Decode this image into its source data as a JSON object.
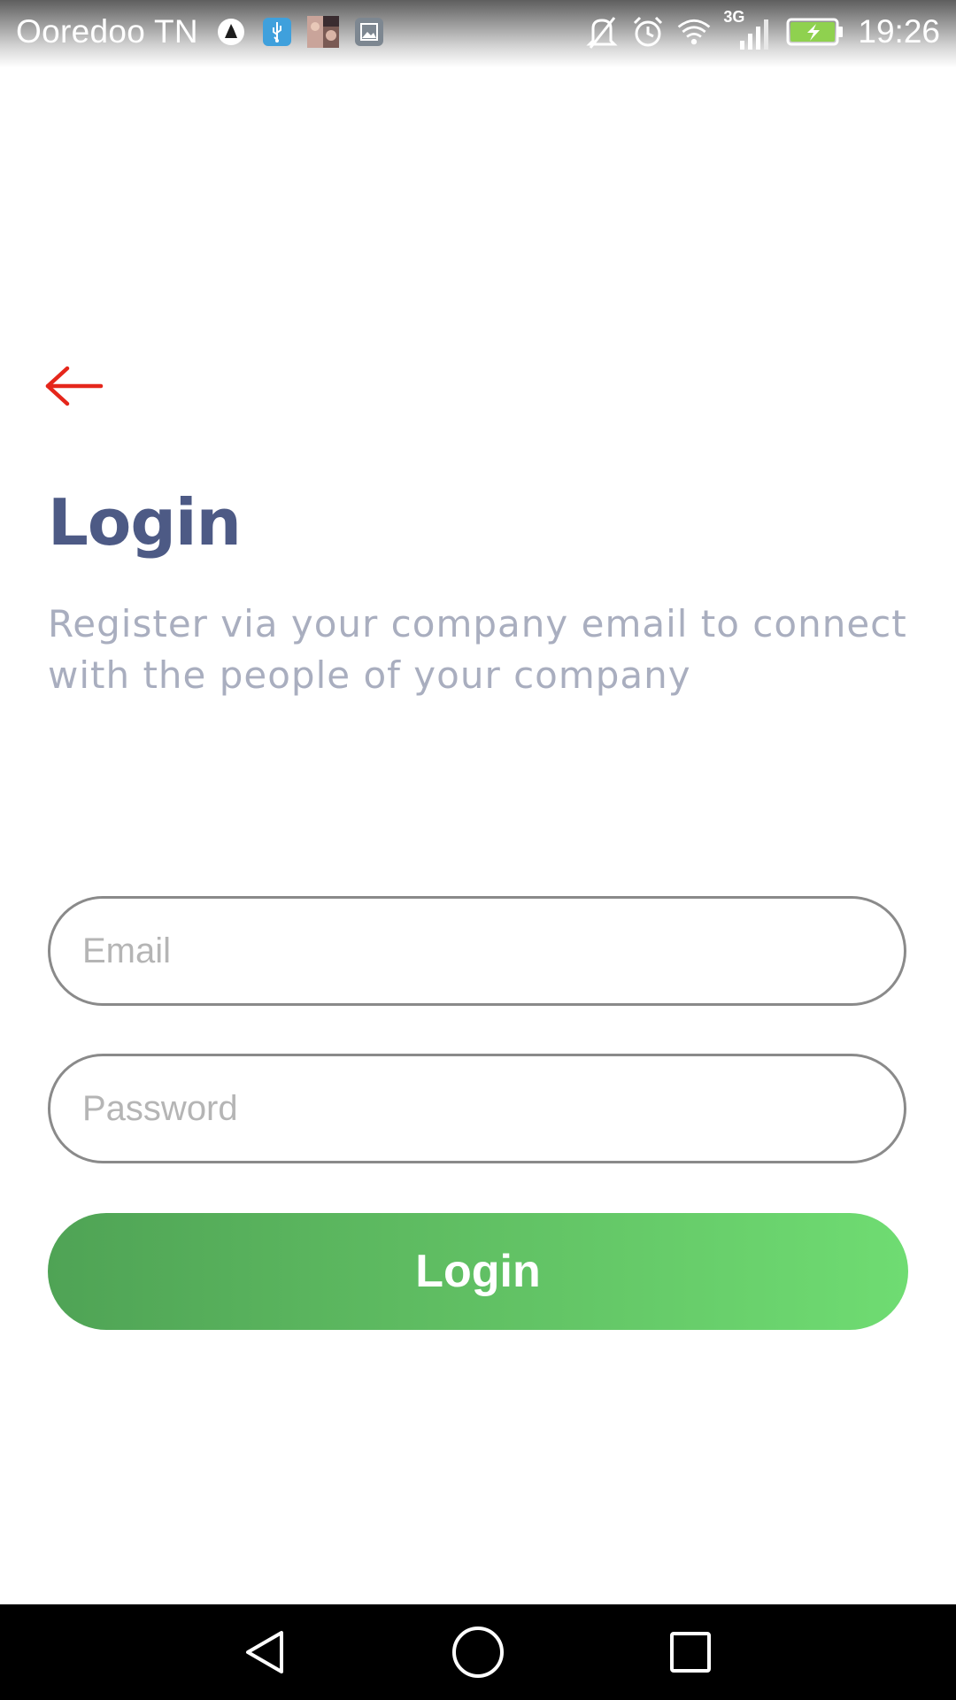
{
  "status_bar": {
    "carrier": "Ooredoo TN",
    "network_type": "3G",
    "time": "19:26",
    "left_icons": [
      "notification-app-icon",
      "usb-icon",
      "photo-thumbnail-icon",
      "gallery-icon"
    ],
    "right_icons": [
      "mute-icon",
      "alarm-icon",
      "wifi-icon",
      "signal-icon",
      "battery-charging-icon"
    ]
  },
  "header": {
    "back_icon": "arrow-left-icon",
    "title": "Login",
    "subtitle": "Register via your company email to connect with the people of your company"
  },
  "form": {
    "email": {
      "value": "",
      "placeholder": "Email"
    },
    "password": {
      "value": "",
      "placeholder": "Password"
    },
    "submit_label": "Login"
  },
  "nav_bar": {
    "buttons": [
      "back-triangle-icon",
      "home-circle-icon",
      "recents-square-icon"
    ]
  },
  "colors": {
    "accent_red": "#e5261b",
    "title": "#4d5a85",
    "subtitle": "#a9aebf",
    "button_gradient_start": "#4fa355",
    "button_gradient_end": "#6fdc72"
  }
}
